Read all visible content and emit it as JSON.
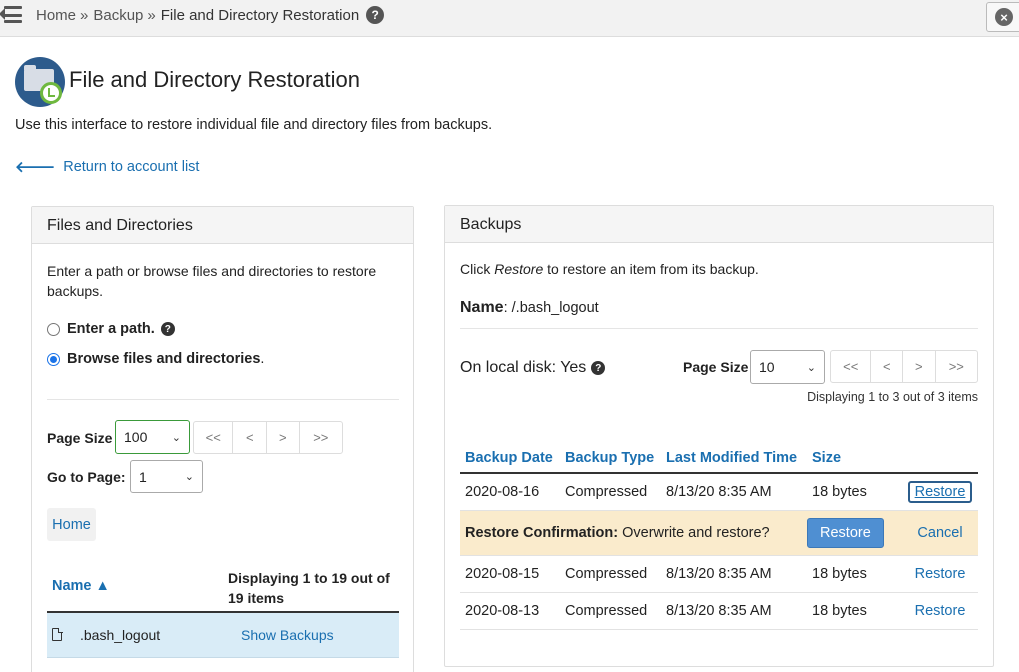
{
  "breadcrumb": {
    "home": "Home",
    "sep1": "»",
    "backup": "Backup",
    "sep2": "»",
    "current": "File and Directory Restoration",
    "help": "?"
  },
  "close": "×",
  "page": {
    "title": "File and Directory Restoration",
    "description": "Use this interface to restore individual file and directory files from backups.",
    "return_arrow": "🡐",
    "return_link": "Return to account list"
  },
  "left_panel": {
    "title": "Files and Directories",
    "description": "Enter a path or browse files and directories to restore backups.",
    "radio_enter_path": "Enter a path.",
    "radio_enter_help": "?",
    "radio_browse": "Browse files and directories",
    "radio_browse_suffix": ".",
    "page_size_label": "Page Size",
    "page_size_value": "100",
    "pager": [
      "<<",
      "<",
      ">",
      ">>"
    ],
    "goto_label": "Go to Page:",
    "goto_value": "1",
    "home_button": "Home",
    "table": {
      "col_name": "Name ▲",
      "col_display": "Displaying 1 to 19 out of 19 items",
      "rows": [
        {
          "name": ".bash_logout",
          "action": "Show Backups"
        }
      ]
    }
  },
  "right_panel": {
    "title": "Backups",
    "description_pre": "Click ",
    "description_em": "Restore",
    "description_post": " to restore an item from its backup.",
    "name_label": "Name",
    "name_value": ": /.bash_logout",
    "local_disk": "On local disk: Yes",
    "local_help": "?",
    "page_size_label": "Page Size",
    "page_size_value": "10",
    "pager": [
      "<<",
      "<",
      ">",
      ">>"
    ],
    "displaying": "Displaying 1 to 3 out of 3 items",
    "table": {
      "columns": [
        "Backup Date",
        "Backup Type",
        "Last Modified Time",
        "Size"
      ],
      "rows": [
        {
          "date": "2020-08-16",
          "type": "Compressed",
          "modified": "8/13/20 8:35 AM",
          "size": "18 bytes",
          "action": "Restore"
        },
        {
          "date": "2020-08-15",
          "type": "Compressed",
          "modified": "8/13/20 8:35 AM",
          "size": "18 bytes",
          "action": "Restore"
        },
        {
          "date": "2020-08-13",
          "type": "Compressed",
          "modified": "8/13/20 8:35 AM",
          "size": "18 bytes",
          "action": "Restore"
        }
      ],
      "confirm": {
        "label": "Restore Confirmation:",
        "text": " Overwrite and restore?",
        "restore": "Restore",
        "cancel": "Cancel"
      }
    }
  },
  "colors": {
    "link": "#1a6fb0",
    "confirm_bg": "#faebcc",
    "selected_row": "#d9ecf7",
    "primary_button": "#4f8fd2"
  },
  "icons": [
    "menu-icon",
    "help-icon",
    "close-icon",
    "restore-folder-icon",
    "arrow-left-icon",
    "file-icon"
  ]
}
